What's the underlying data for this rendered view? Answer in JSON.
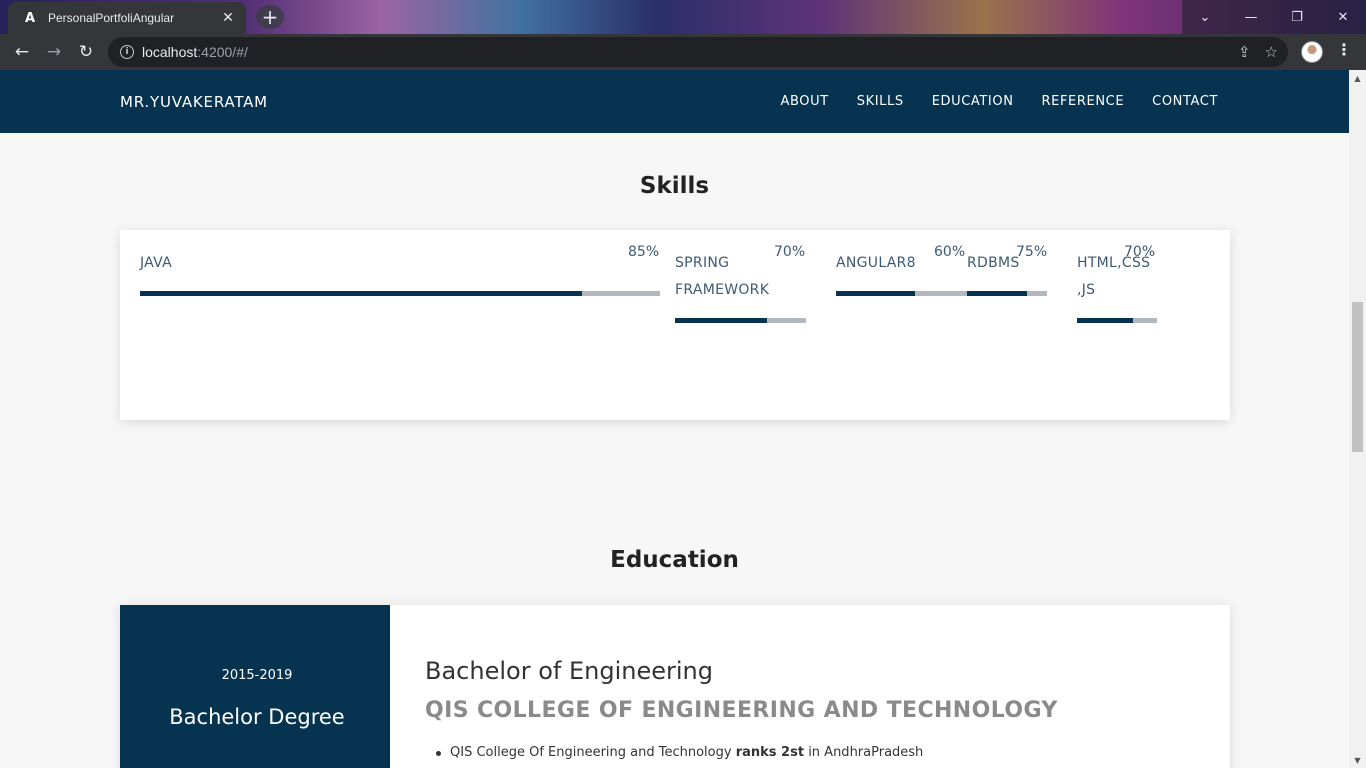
{
  "browser": {
    "tab_title": "PersonalPortfoliAngular",
    "tab_icon": "angular-icon",
    "url_host": "localhost",
    "url_path": ":4200/#/"
  },
  "nav": {
    "brand": "MR.YUVAKERATAM",
    "links": [
      "ABOUT",
      "SKILLS",
      "EDUCATION",
      "REFERENCE",
      "CONTACT"
    ]
  },
  "skills": {
    "title": "Skills",
    "items": [
      {
        "label": "JAVA",
        "percent_text": "85%",
        "value": 85
      },
      {
        "label": "SPRING FRAMEWORK",
        "percent_text": "70%",
        "value": 70
      },
      {
        "label": "ANGULAR8",
        "percent_text": "60%",
        "value": 60
      },
      {
        "label": "RDBMS",
        "percent_text": "75%",
        "value": 75
      },
      {
        "label": "HTML,CSS ,JS",
        "percent_text": "70%",
        "value": 70
      }
    ]
  },
  "education": {
    "title": "Education",
    "years": "2015-2019",
    "degree_short": "Bachelor Degree",
    "degree": "Bachelor of Engineering",
    "college": "QIS COLLEGE OF ENGINEERING AND TECHNOLOGY",
    "bullet_prefix": "QIS College Of Engineering and Technology ",
    "bullet_bold": "ranks 2st",
    "bullet_suffix": " in AndhraPradesh"
  },
  "colors": {
    "primary": "#06334f",
    "bar_track": "#b1b8bf",
    "skill_text": "#3e5a73"
  }
}
